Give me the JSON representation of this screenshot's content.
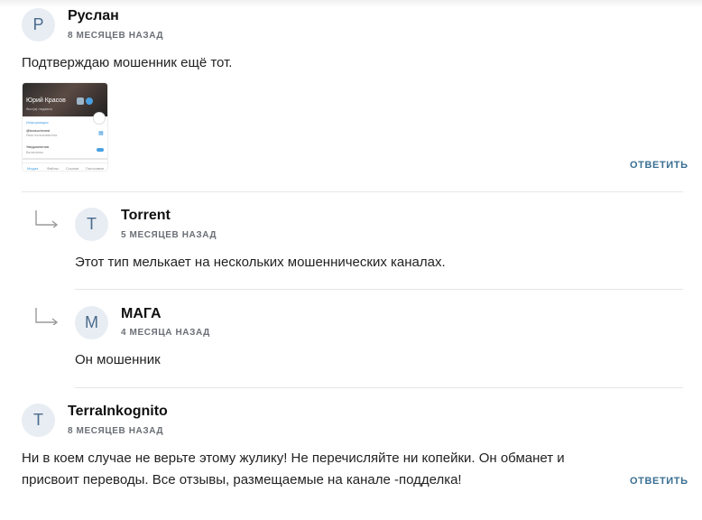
{
  "reply_label": "ОТВЕТИТЬ",
  "comments": [
    {
      "avatar_letter": "Р",
      "author": "Руслан",
      "date": "8 МЕСЯЦЕВ НАЗАД",
      "text": "Подтверждаю мошенник ещё тот.",
      "attachment": {
        "name": "Юрий Красов",
        "subtitle": "был(а) недавно",
        "section": "Информация",
        "username": "@krasovinvest",
        "username_caption": "Имя пользователя",
        "notifications": "Уведомления",
        "notifications_caption": "Включены",
        "tabs": [
          "Медиа",
          "Файлы",
          "Ссылки",
          "Голосовые"
        ]
      },
      "replies": [
        {
          "avatar_letter": "T",
          "author": "Torrent",
          "date": "5 МЕСЯЦЕВ НАЗАД",
          "text": "Этот тип мелькает на нескольких мошеннических каналах."
        },
        {
          "avatar_letter": "М",
          "author": "МАГА",
          "date": "4 МЕСЯЦА НАЗАД",
          "text": "Он мошенник"
        }
      ]
    },
    {
      "avatar_letter": "T",
      "author": "TerraInkognito",
      "date": "8 МЕСЯЦЕВ НАЗАД",
      "text": "Ни в коем случае не верьте этому жулику! Не перечисляйте ни копейки. Он обманет и присвоит переводы. Все отзывы, размещаемые на канале -подделка!"
    }
  ]
}
